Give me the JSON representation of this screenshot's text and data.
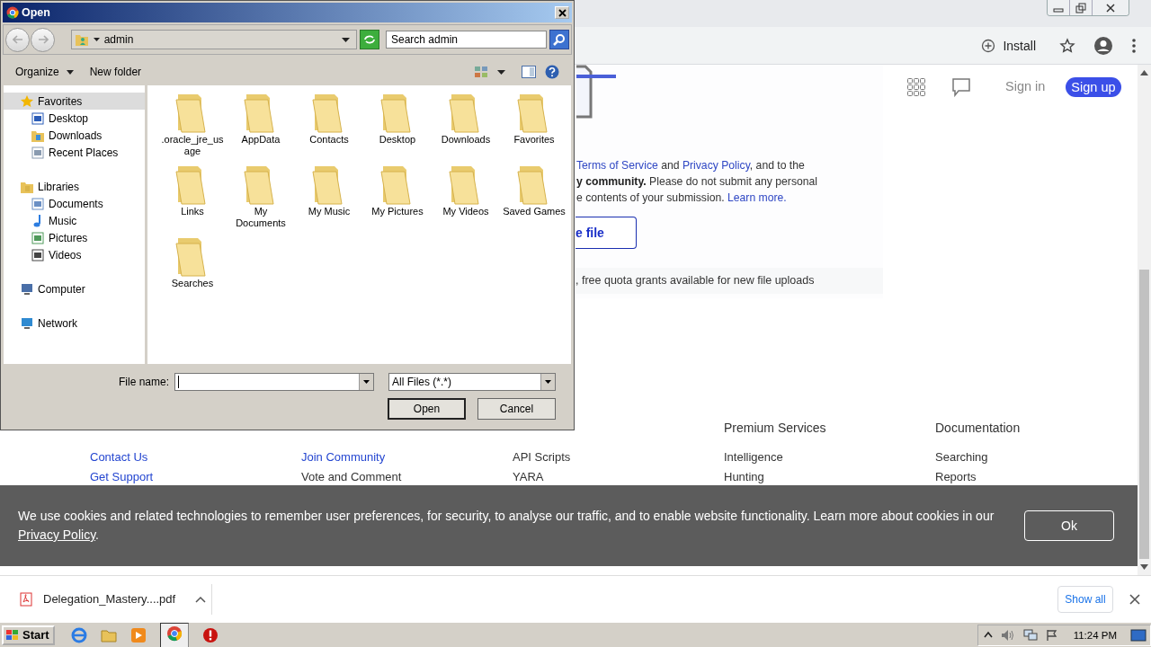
{
  "browser": {
    "toolbar": {
      "install": "Install"
    },
    "page": {
      "terms_lines": [
        [
          {
            "kind": "link",
            "text": "Terms of Service"
          },
          {
            "kind": "text",
            "text": " and "
          },
          {
            "kind": "link",
            "text": "Privacy Policy"
          },
          {
            "kind": "text",
            "text": ", and to the"
          }
        ],
        [
          {
            "kind": "bold",
            "text": "y community."
          },
          {
            "kind": "text",
            "text": " Please do not submit any personal"
          }
        ],
        [
          {
            "kind": "text",
            "text": "e contents of your submission. "
          },
          {
            "kind": "link",
            "text": "Learn more."
          }
        ]
      ],
      "choose_button": "e file",
      "quota": ", free quota grants available for new file uploads"
    },
    "header": {
      "sign_in": "Sign in",
      "sign_up": "Sign up"
    },
    "footer": [
      {
        "links": [
          {
            "label": "Contact Us",
            "link": true
          },
          {
            "label": "Get Support",
            "link": true
          }
        ]
      },
      {
        "links": [
          {
            "label": "Join Community",
            "link": true
          },
          {
            "label": "Vote and Comment",
            "link": false
          }
        ]
      },
      {
        "links": [
          {
            "label": "API Scripts",
            "link": false
          },
          {
            "label": "YARA",
            "link": false
          }
        ]
      },
      {
        "heading": "Premium Services",
        "links": [
          {
            "label": "Intelligence",
            "link": false
          },
          {
            "label": "Hunting",
            "link": false
          }
        ]
      },
      {
        "heading": "Documentation",
        "links": [
          {
            "label": "Searching",
            "link": false
          },
          {
            "label": "Reports",
            "link": false
          }
        ]
      }
    ],
    "cookie_banner": {
      "segments": [
        {
          "kind": "text",
          "text": "We use cookies and related technologies to remember user preferences, for security, to analyse our traffic, and to enable website functionality. Learn more about cookies in our "
        },
        {
          "kind": "link",
          "text": "Privacy Policy"
        },
        {
          "kind": "text",
          "text": "."
        }
      ],
      "button": "Ok"
    },
    "download_bar": {
      "file": "Delegation_Mastery....pdf",
      "show_all": "Show all"
    }
  },
  "dialog": {
    "title": "Open",
    "address": "admin",
    "search": {
      "placeholder": "Search admin"
    },
    "organize": "Organize",
    "new_folder": "New folder",
    "nav": [
      {
        "label": "Favorites",
        "selected": true,
        "children": [
          {
            "label": "Desktop",
            "selected": false
          },
          {
            "label": "Downloads",
            "selected": false
          },
          {
            "label": "Recent Places",
            "selected": false
          }
        ]
      },
      {
        "label": "Libraries",
        "selected": false,
        "children": [
          {
            "label": "Documents",
            "selected": false
          },
          {
            "label": "Music",
            "selected": false
          },
          {
            "label": "Pictures",
            "selected": false
          },
          {
            "label": "Videos",
            "selected": false
          }
        ]
      },
      {
        "label": "Computer",
        "selected": false
      },
      {
        "label": "Network",
        "selected": false
      }
    ],
    "items": [
      {
        "name": ".oracle_jre_usage"
      },
      {
        "name": "AppData"
      },
      {
        "name": "Contacts"
      },
      {
        "name": "Desktop"
      },
      {
        "name": "Downloads"
      },
      {
        "name": "Favorites"
      },
      {
        "name": "Links"
      },
      {
        "name": "My Documents"
      },
      {
        "name": "My Music"
      },
      {
        "name": "My Pictures"
      },
      {
        "name": "My Videos"
      },
      {
        "name": "Saved Games"
      },
      {
        "name": "Searches"
      }
    ],
    "file_name_label": "File name:",
    "file_type": "All Files (*.*)",
    "buttons": [
      "Open",
      "Cancel"
    ]
  },
  "taskbar": {
    "start": "Start",
    "clock": "11:24 PM"
  }
}
